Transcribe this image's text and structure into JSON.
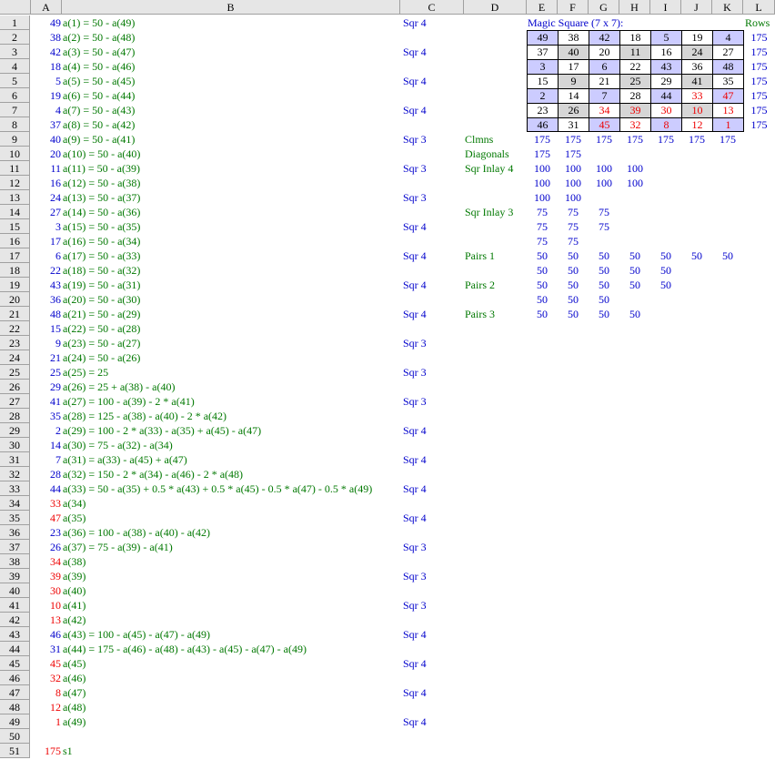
{
  "columns": [
    "A",
    "B",
    "C",
    "D",
    "E",
    "F",
    "G",
    "H",
    "I",
    "J",
    "K",
    "L"
  ],
  "rows": [
    "1",
    "2",
    "3",
    "4",
    "5",
    "6",
    "7",
    "8",
    "9",
    "10",
    "11",
    "12",
    "13",
    "14",
    "15",
    "16",
    "17",
    "18",
    "19",
    "20",
    "21",
    "22",
    "23",
    "24",
    "25",
    "26",
    "27",
    "28",
    "29",
    "30",
    "31",
    "32",
    "33",
    "34",
    "35",
    "36",
    "37",
    "38",
    "39",
    "40",
    "41",
    "42",
    "43",
    "44",
    "45",
    "46",
    "47",
    "48",
    "49",
    "50",
    "51"
  ],
  "colA": [
    {
      "v": "49",
      "c": "blu"
    },
    {
      "v": "38",
      "c": "blu"
    },
    {
      "v": "42",
      "c": "blu"
    },
    {
      "v": "18",
      "c": "blu"
    },
    {
      "v": "5",
      "c": "blu"
    },
    {
      "v": "19",
      "c": "blu"
    },
    {
      "v": "4",
      "c": "blu"
    },
    {
      "v": "37",
      "c": "blu"
    },
    {
      "v": "40",
      "c": "blu"
    },
    {
      "v": "20",
      "c": "blu"
    },
    {
      "v": "11",
      "c": "blu"
    },
    {
      "v": "16",
      "c": "blu"
    },
    {
      "v": "24",
      "c": "blu"
    },
    {
      "v": "27",
      "c": "blu"
    },
    {
      "v": "3",
      "c": "blu"
    },
    {
      "v": "17",
      "c": "blu"
    },
    {
      "v": "6",
      "c": "blu"
    },
    {
      "v": "22",
      "c": "blu"
    },
    {
      "v": "43",
      "c": "blu"
    },
    {
      "v": "36",
      "c": "blu"
    },
    {
      "v": "48",
      "c": "blu"
    },
    {
      "v": "15",
      "c": "blu"
    },
    {
      "v": "9",
      "c": "blu"
    },
    {
      "v": "21",
      "c": "blu"
    },
    {
      "v": "25",
      "c": "blu"
    },
    {
      "v": "29",
      "c": "blu"
    },
    {
      "v": "41",
      "c": "blu"
    },
    {
      "v": "35",
      "c": "blu"
    },
    {
      "v": "2",
      "c": "blu"
    },
    {
      "v": "14",
      "c": "blu"
    },
    {
      "v": "7",
      "c": "blu"
    },
    {
      "v": "28",
      "c": "blu"
    },
    {
      "v": "44",
      "c": "blu"
    },
    {
      "v": "33",
      "c": "red"
    },
    {
      "v": "47",
      "c": "red"
    },
    {
      "v": "23",
      "c": "blu"
    },
    {
      "v": "26",
      "c": "blu"
    },
    {
      "v": "34",
      "c": "red"
    },
    {
      "v": "39",
      "c": "red"
    },
    {
      "v": "30",
      "c": "red"
    },
    {
      "v": "10",
      "c": "red"
    },
    {
      "v": "13",
      "c": "red"
    },
    {
      "v": "46",
      "c": "blu"
    },
    {
      "v": "31",
      "c": "blu"
    },
    {
      "v": "45",
      "c": "red"
    },
    {
      "v": "32",
      "c": "red"
    },
    {
      "v": "8",
      "c": "red"
    },
    {
      "v": "12",
      "c": "red"
    },
    {
      "v": "1",
      "c": "red"
    },
    {
      "v": "",
      "c": "blu"
    },
    {
      "v": "175",
      "c": "red"
    }
  ],
  "colB": [
    "a(1) = 50 - a(49)",
    "a(2) = 50 - a(48)",
    "a(3) = 50 - a(47)",
    "a(4) = 50 - a(46)",
    "a(5) = 50 - a(45)",
    "a(6) = 50 - a(44)",
    "a(7) = 50 - a(43)",
    "a(8) = 50 - a(42)",
    "a(9) = 50 - a(41)",
    "a(10) = 50 - a(40)",
    "a(11) = 50 - a(39)",
    "a(12) = 50 - a(38)",
    "a(13) = 50 - a(37)",
    "a(14) = 50 - a(36)",
    "a(15) = 50 - a(35)",
    "a(16) = 50 - a(34)",
    "a(17) = 50 - a(33)",
    "a(18) = 50 - a(32)",
    "a(19) = 50 - a(31)",
    "a(20) = 50 - a(30)",
    "a(21) = 50 - a(29)",
    "a(22) = 50 - a(28)",
    "a(23) = 50 - a(27)",
    "a(24) = 50 - a(26)",
    "a(25) = 25",
    "a(26) = 25 + a(38) - a(40)",
    "a(27) = 100 - a(39) - 2 * a(41)",
    "a(28) = 125 - a(38) - a(40) - 2 * a(42)",
    "a(29) = 100 - 2 * a(33) - a(35) + a(45) - a(47)",
    "a(30) = 75 - a(32) - a(34)",
    "a(31) = a(33) - a(45) + a(47)",
    "a(32) = 150 - 2 * a(34) - a(46) - 2 * a(48)",
    "a(33) = 50 - a(35) + 0.5 * a(43) + 0.5 * a(45) - 0.5 * a(47) - 0.5 * a(49)",
    "a(34)",
    "a(35)",
    "a(36) = 100 - a(38) - a(40) - a(42)",
    "a(37) = 75 - a(39) - a(41)",
    "a(38)",
    "a(39)",
    "a(40)",
    "a(41)",
    "a(42)",
    "a(43) = 100 - a(45) - a(47) - a(49)",
    "a(44) = 175 - a(46) - a(48) - a(43) - a(45) - a(47) - a(49)",
    "a(45)",
    "a(46)",
    "a(47)",
    "a(48)",
    "a(49)",
    "",
    "s1"
  ],
  "colC": [
    "Sqr 4",
    "",
    "Sqr 4",
    "",
    "Sqr 4",
    "",
    "Sqr 4",
    "",
    "Sqr 3",
    "",
    "Sqr 3",
    "",
    "Sqr 3",
    "",
    "Sqr 4",
    "",
    "Sqr 4",
    "",
    "Sqr 4",
    "",
    "Sqr 4",
    "",
    "Sqr 3",
    "",
    "Sqr 3",
    "",
    "Sqr 3",
    "",
    "Sqr 4",
    "",
    "Sqr 4",
    "",
    "Sqr 4",
    "",
    "Sqr 4",
    "",
    "Sqr 3",
    "",
    "Sqr 3",
    "",
    "Sqr 3",
    "",
    "Sqr 4",
    "",
    "Sqr 4",
    "",
    "Sqr 4",
    "",
    "Sqr 4",
    "",
    ""
  ],
  "magic_title": "Magic Square (7 x 7):",
  "rows_label": "Rows",
  "magic": [
    [
      {
        "v": "49",
        "b": "blue"
      },
      {
        "v": "38",
        "b": "white"
      },
      {
        "v": "42",
        "b": "blue"
      },
      {
        "v": "18",
        "b": "white"
      },
      {
        "v": "5",
        "b": "blue"
      },
      {
        "v": "19",
        "b": "white"
      },
      {
        "v": "4",
        "b": "blue"
      }
    ],
    [
      {
        "v": "37",
        "b": "white"
      },
      {
        "v": "40",
        "b": "gray"
      },
      {
        "v": "20",
        "b": "white"
      },
      {
        "v": "11",
        "b": "gray"
      },
      {
        "v": "16",
        "b": "white"
      },
      {
        "v": "24",
        "b": "gray"
      },
      {
        "v": "27",
        "b": "white"
      }
    ],
    [
      {
        "v": "3",
        "b": "blue"
      },
      {
        "v": "17",
        "b": "white"
      },
      {
        "v": "6",
        "b": "blue"
      },
      {
        "v": "22",
        "b": "white"
      },
      {
        "v": "43",
        "b": "blue"
      },
      {
        "v": "36",
        "b": "white"
      },
      {
        "v": "48",
        "b": "blue"
      }
    ],
    [
      {
        "v": "15",
        "b": "white"
      },
      {
        "v": "9",
        "b": "gray"
      },
      {
        "v": "21",
        "b": "white"
      },
      {
        "v": "25",
        "b": "gray"
      },
      {
        "v": "29",
        "b": "white"
      },
      {
        "v": "41",
        "b": "gray"
      },
      {
        "v": "35",
        "b": "white"
      }
    ],
    [
      {
        "v": "2",
        "b": "blue"
      },
      {
        "v": "14",
        "b": "white"
      },
      {
        "v": "7",
        "b": "blue"
      },
      {
        "v": "28",
        "b": "white"
      },
      {
        "v": "44",
        "b": "blue"
      },
      {
        "v": "33",
        "b": "white",
        "r": true
      },
      {
        "v": "47",
        "b": "blue",
        "r": true
      }
    ],
    [
      {
        "v": "23",
        "b": "white"
      },
      {
        "v": "26",
        "b": "gray"
      },
      {
        "v": "34",
        "b": "white",
        "r": true
      },
      {
        "v": "39",
        "b": "gray",
        "r": true
      },
      {
        "v": "30",
        "b": "white",
        "r": true
      },
      {
        "v": "10",
        "b": "gray",
        "r": true
      },
      {
        "v": "13",
        "b": "white",
        "r": true
      }
    ],
    [
      {
        "v": "46",
        "b": "blue"
      },
      {
        "v": "31",
        "b": "white"
      },
      {
        "v": "45",
        "b": "blue",
        "r": true
      },
      {
        "v": "32",
        "b": "white",
        "r": true
      },
      {
        "v": "8",
        "b": "blue",
        "r": true
      },
      {
        "v": "12",
        "b": "white",
        "r": true
      },
      {
        "v": "1",
        "b": "blue",
        "r": true
      }
    ]
  ],
  "row_sums": [
    "175",
    "175",
    "175",
    "175",
    "175",
    "175",
    "175"
  ],
  "labels": [
    {
      "row": 9,
      "text": "Clmns"
    },
    {
      "row": 10,
      "text": "Diagonals"
    },
    {
      "row": 11,
      "text": "Sqr Inlay 4"
    },
    {
      "row": 14,
      "text": "Sqr Inlay 3"
    },
    {
      "row": 17,
      "text": "Pairs 1"
    },
    {
      "row": 19,
      "text": "Pairs 2"
    },
    {
      "row": 21,
      "text": "Pairs 3"
    }
  ],
  "sums": [
    {
      "row": 9,
      "vals": [
        "175",
        "175",
        "175",
        "175",
        "175",
        "175",
        "175"
      ]
    },
    {
      "row": 10,
      "vals": [
        "175",
        "175"
      ]
    },
    {
      "row": 11,
      "vals": [
        "100",
        "100",
        "100",
        "100"
      ]
    },
    {
      "row": 12,
      "vals": [
        "100",
        "100",
        "100",
        "100"
      ]
    },
    {
      "row": 13,
      "vals": [
        "100",
        "100"
      ]
    },
    {
      "row": 14,
      "vals": [
        "75",
        "75",
        "75"
      ]
    },
    {
      "row": 15,
      "vals": [
        "75",
        "75",
        "75"
      ]
    },
    {
      "row": 16,
      "vals": [
        "75",
        "75"
      ]
    },
    {
      "row": 17,
      "vals": [
        "50",
        "50",
        "50",
        "50",
        "50",
        "50",
        "50"
      ]
    },
    {
      "row": 18,
      "vals": [
        "50",
        "50",
        "50",
        "50",
        "50"
      ]
    },
    {
      "row": 19,
      "vals": [
        "50",
        "50",
        "50",
        "50",
        "50"
      ]
    },
    {
      "row": 20,
      "vals": [
        "50",
        "50",
        "50"
      ]
    },
    {
      "row": 21,
      "vals": [
        "50",
        "50",
        "50",
        "50"
      ]
    }
  ]
}
